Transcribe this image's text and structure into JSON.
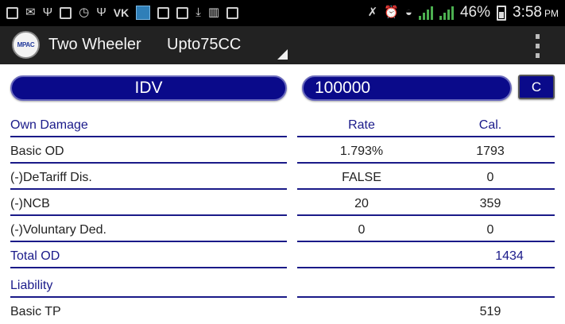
{
  "status_bar": {
    "left_icons": [
      "facebook-icon",
      "mail-icon",
      "usb-icon",
      "gallery-icon",
      "clock-icon",
      "usb-icon",
      "vk-icon",
      "app-icon",
      "image-icon",
      "photo-icon",
      "download-icon",
      "barcode-icon",
      "clipboard-icon"
    ],
    "vk_text": "VK",
    "battery_percent": "46%",
    "time": "3:58",
    "ampm": "PM"
  },
  "action_bar": {
    "logo_text": "MPAC",
    "title": "Two Wheeler",
    "spinner_value": "Upto75CC"
  },
  "form": {
    "idv_label": "IDV",
    "idv_value": "100000",
    "calc_button": "C"
  },
  "table": {
    "headers": {
      "section": "Own Damage",
      "rate": "Rate",
      "cal": "Cal."
    },
    "rows": [
      {
        "label": "Basic OD",
        "rate": "1.793%",
        "cal": "1793"
      },
      {
        "label": "(-)DeTariff Dis.",
        "rate": "FALSE",
        "cal": "0"
      },
      {
        "label": "(-)NCB",
        "rate": "20",
        "cal": "359"
      },
      {
        "label": "(-)Voluntary Ded.",
        "rate": "0",
        "cal": "0"
      }
    ],
    "total_od": {
      "label": "Total OD",
      "cal": "1434"
    },
    "liability": {
      "label": "Liability"
    },
    "basic_tp": {
      "label": "Basic TP",
      "cal": "519"
    }
  },
  "colors": {
    "accent": "#0a0a8a",
    "action_bar": "#222222",
    "status_bar": "#000000",
    "heading_text": "#1a1a8a"
  }
}
